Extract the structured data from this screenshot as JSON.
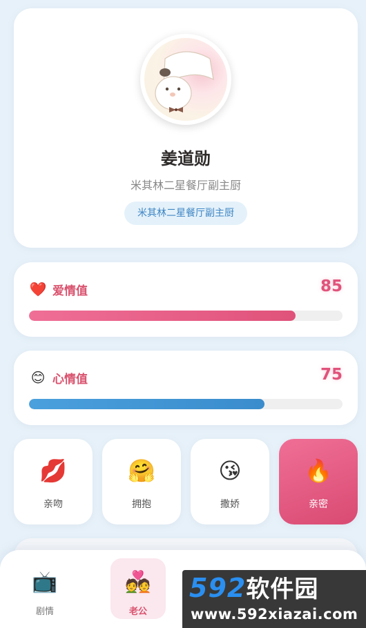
{
  "profile": {
    "name": "姜道勋",
    "subtitle": "米其林二星餐厅副主厨",
    "tag": "米其林二星餐厅副主厨"
  },
  "stats": [
    {
      "emoji": "❤️",
      "label": "爱情值",
      "value": "85",
      "percent": 85,
      "color": "#e0527a"
    },
    {
      "emoji": "😊",
      "label": "心情值",
      "value": "75",
      "percent": 75,
      "color": "#3a8ccc"
    }
  ],
  "actions": [
    {
      "icon": "💋",
      "label": "亲吻",
      "icon_name": "kiss-lips-icon"
    },
    {
      "icon": "🤗",
      "label": "拥抱",
      "icon_name": "hug-icon"
    },
    {
      "icon": "😘",
      "label": "撒娇",
      "icon_name": "blow-kiss-icon"
    },
    {
      "icon": "🔥",
      "label": "亲密",
      "icon_name": "fire-icon",
      "active": true
    }
  ],
  "nav": [
    {
      "icon": "📺",
      "label": "剧情",
      "icon_name": "tv-icon"
    },
    {
      "icon": "💑",
      "label": "老公",
      "icon_name": "couple-icon",
      "selected": true
    }
  ],
  "watermark": {
    "number": "592",
    "brand": "软件园",
    "url": "www.592xiazai.com"
  },
  "colors": {
    "accent_pink": "#e0527a",
    "accent_blue": "#3a8ccc",
    "background": "#e7f1f9"
  }
}
